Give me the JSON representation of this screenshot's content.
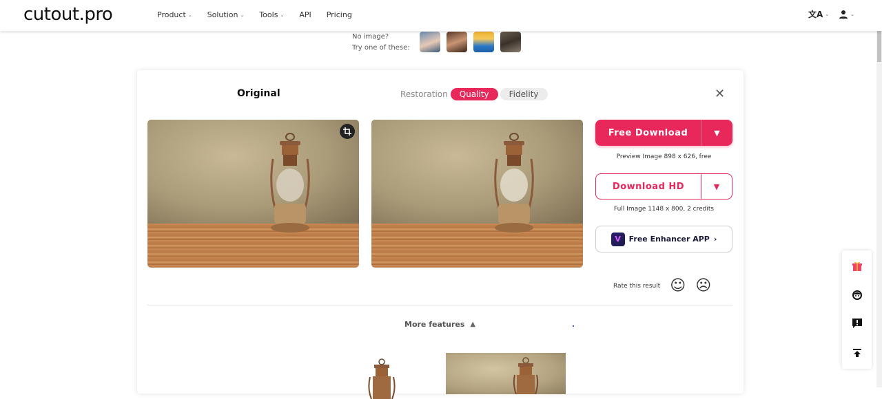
{
  "header": {
    "logo": "cutout.pro",
    "nav": [
      {
        "label": "Product",
        "has_dropdown": true
      },
      {
        "label": "Solution",
        "has_dropdown": true
      },
      {
        "label": "Tools",
        "has_dropdown": true
      },
      {
        "label": "API",
        "has_dropdown": false
      },
      {
        "label": "Pricing",
        "has_dropdown": false
      }
    ],
    "icons": [
      "translate-icon",
      "user-icon"
    ]
  },
  "samples": {
    "line1": "No image?",
    "line2": "Try one of these:",
    "thumbnails": [
      "sample-girl",
      "sample-woman",
      "sample-anime",
      "sample-vintage-portrait"
    ]
  },
  "editor": {
    "original_label": "Original",
    "mode_label": "Restoration",
    "modes": [
      {
        "label": "Quality",
        "active": true
      },
      {
        "label": "Fidelity",
        "active": false
      }
    ],
    "accent_color": "#e8275a",
    "free_download": {
      "label": "Free Download",
      "note": "Preview Image 898 x 626, free"
    },
    "download_hd": {
      "label": "Download HD",
      "note": "Full Image 1148 x 800, 2 credits"
    },
    "app_button": {
      "label": "Free Enhancer APP",
      "chevron": "›"
    },
    "rate_label": "Rate this result",
    "more_features": "More features"
  },
  "glyphs": {
    "caret": "⌄",
    "close": "✕",
    "drop": "▼",
    "up": "▲",
    "smile": "☺",
    "frown": "☹",
    "crop": "⛶",
    "translate": "文A",
    "user": "👤",
    "gift": "🎁",
    "support": "☻",
    "feedback": "❗",
    "top": "⤒"
  }
}
